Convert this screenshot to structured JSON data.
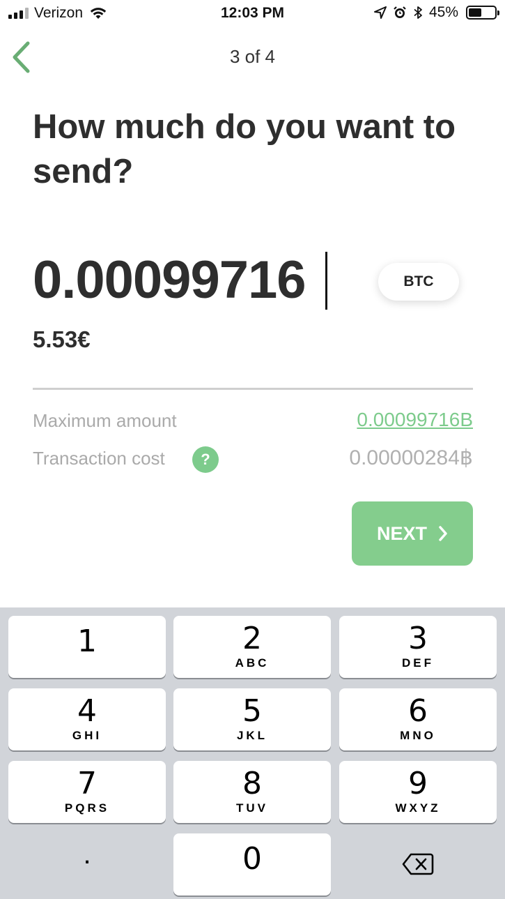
{
  "status_bar": {
    "carrier": "Verizon",
    "time": "12:03 PM",
    "battery": "45%",
    "battery_level": 0.45
  },
  "nav": {
    "step": "3 of 4"
  },
  "title": "How much do you want to send?",
  "amount": {
    "value": "0.00099716",
    "currency": "BTC",
    "fiat": "5.53€"
  },
  "details": {
    "max_label": "Maximum amount",
    "max_value": "0.00099716B",
    "cost_label": "Transaction cost",
    "help_glyph": "?",
    "cost_value": "0.00000284฿"
  },
  "next_button": {
    "label": "NEXT"
  },
  "keypad": {
    "keys": [
      {
        "digit": "1",
        "letters": ""
      },
      {
        "digit": "2",
        "letters": "ABC"
      },
      {
        "digit": "3",
        "letters": "DEF"
      },
      {
        "digit": "4",
        "letters": "GHI"
      },
      {
        "digit": "5",
        "letters": "JKL"
      },
      {
        "digit": "6",
        "letters": "MNO"
      },
      {
        "digit": "7",
        "letters": "PQRS"
      },
      {
        "digit": "8",
        "letters": "TUV"
      },
      {
        "digit": "9",
        "letters": "WXYZ"
      },
      {
        "digit": ".",
        "letters": ""
      },
      {
        "digit": "0",
        "letters": ""
      }
    ]
  },
  "colors": {
    "accent_green": "#7dcb8c",
    "button_green": "#84cd8d",
    "keypad_bg": "#d1d4d9"
  }
}
